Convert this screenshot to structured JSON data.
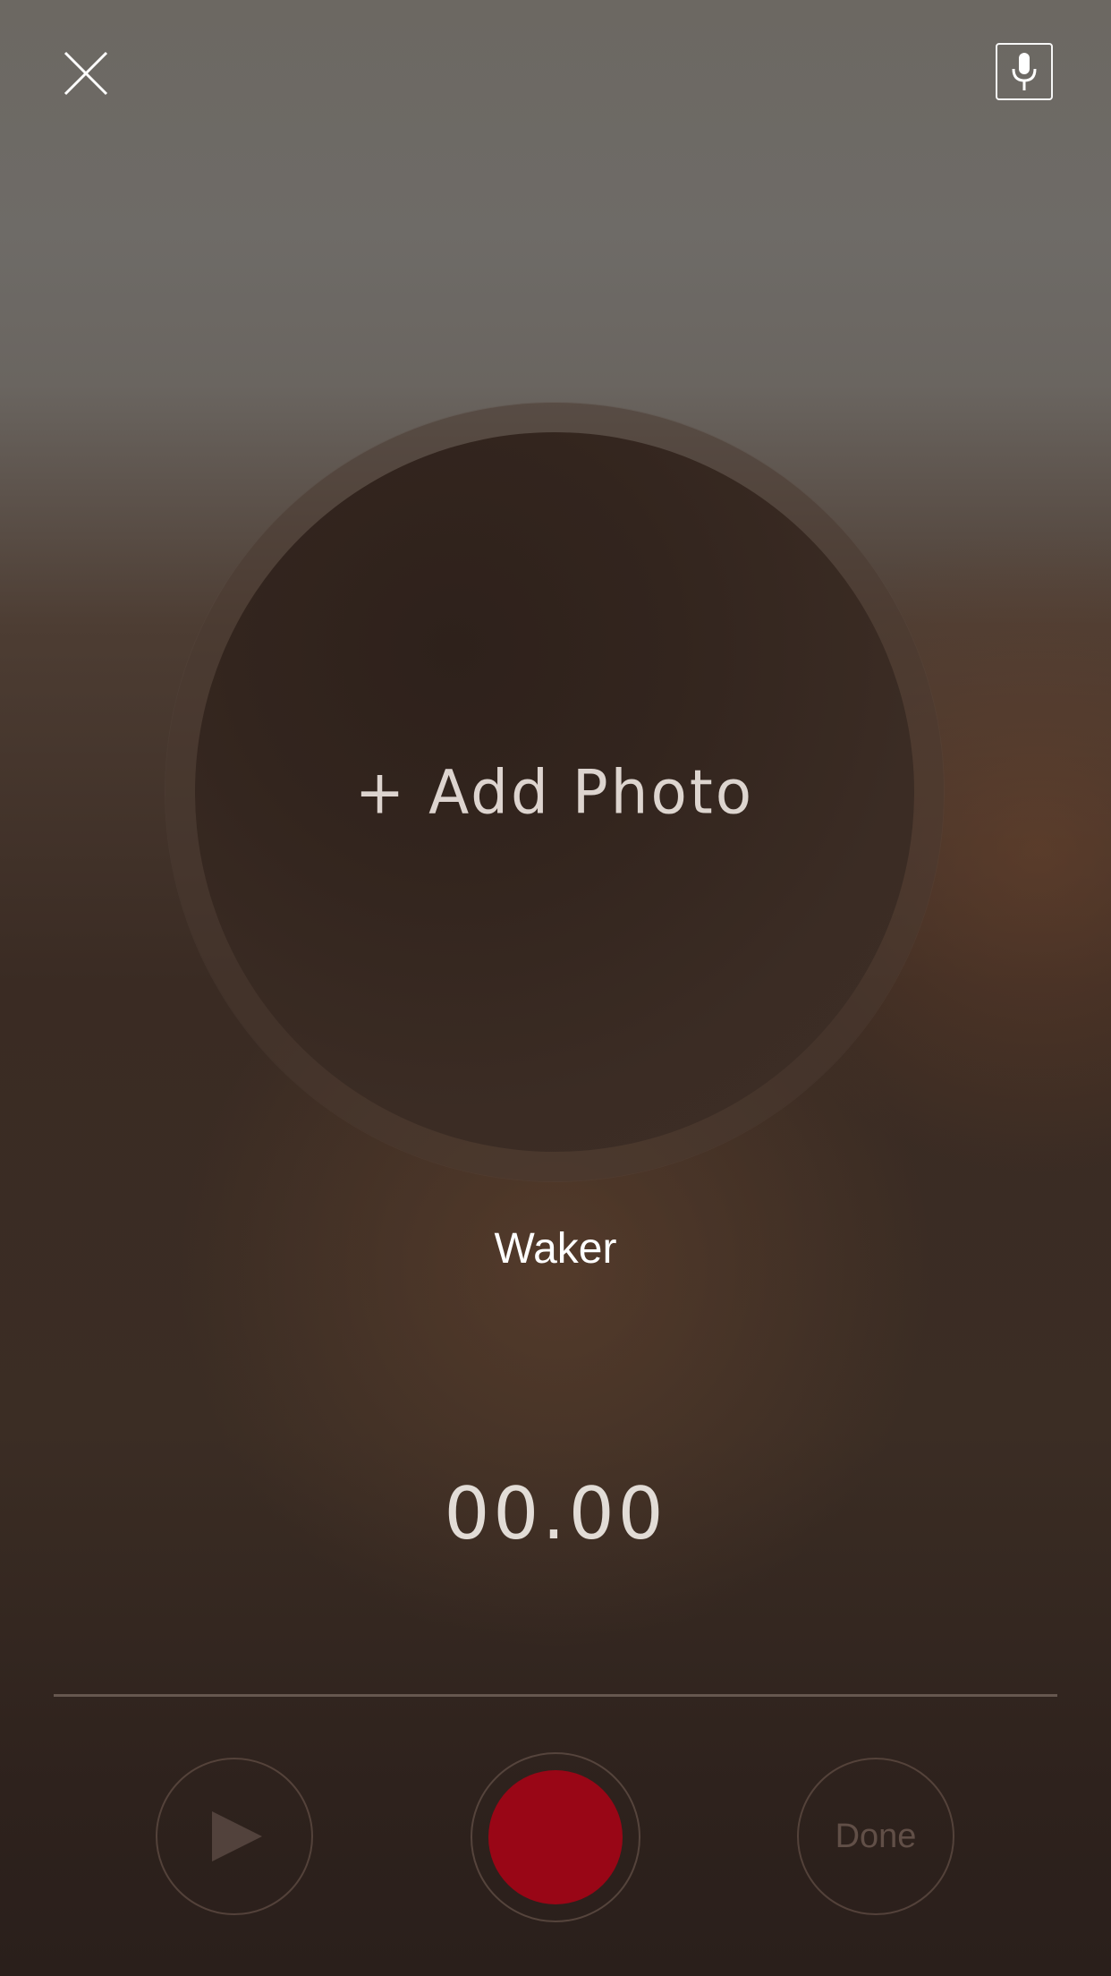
{
  "header": {
    "close_icon": "close-icon",
    "mic_icon": "microphone-icon"
  },
  "photo": {
    "add_label": "+ Add Photo"
  },
  "recording": {
    "name": "Waker",
    "timer": "00.00"
  },
  "controls": {
    "play_icon": "play-icon",
    "record_icon": "record-icon",
    "done_label": "Done"
  },
  "colors": {
    "record_red": "#990616",
    "icon_white": "#ffffff"
  }
}
